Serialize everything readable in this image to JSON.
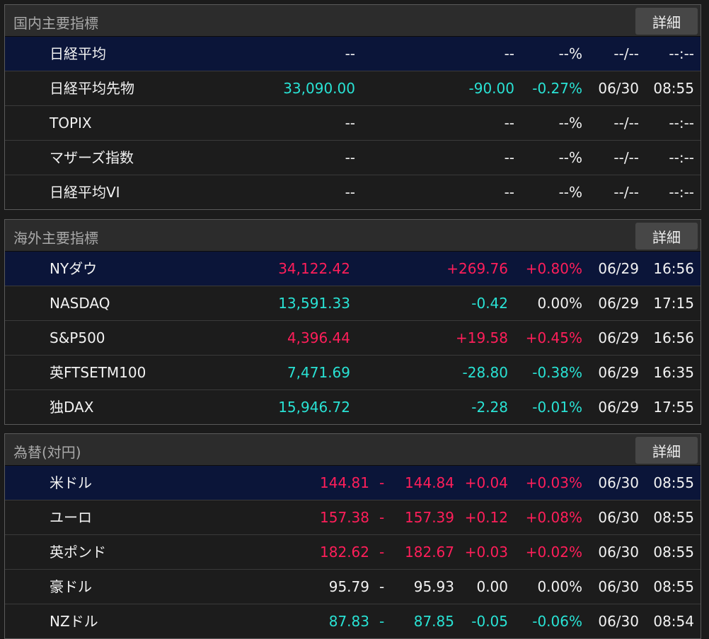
{
  "colors": {
    "up": "#ff1e5a",
    "down": "#29e2d4",
    "flat": "#f2f2f2",
    "selected_row": "#0b1539"
  },
  "domestic": {
    "title": "国内主要指標",
    "detail_label": "詳細",
    "rows": [
      {
        "name": "日経平均",
        "price": "--",
        "change": "--",
        "pct": "--%",
        "date": "--/--",
        "time": "--:--"
      },
      {
        "name": "日経平均先物",
        "price": "33,090.00",
        "change": "-90.00",
        "pct": "-0.27%",
        "date": "06/30",
        "time": "08:55"
      },
      {
        "name": "TOPIX",
        "price": "--",
        "change": "--",
        "pct": "--%",
        "date": "--/--",
        "time": "--:--"
      },
      {
        "name": "マザーズ指数",
        "price": "--",
        "change": "--",
        "pct": "--%",
        "date": "--/--",
        "time": "--:--"
      },
      {
        "name": "日経平均VI",
        "price": "--",
        "change": "--",
        "pct": "--%",
        "date": "--/--",
        "time": "--:--"
      }
    ]
  },
  "overseas": {
    "title": "海外主要指標",
    "detail_label": "詳細",
    "rows": [
      {
        "name": "NYダウ",
        "price": "34,122.42",
        "change": "+269.76",
        "pct": "+0.80%",
        "date": "06/29",
        "time": "16:56"
      },
      {
        "name": "NASDAQ",
        "price": "13,591.33",
        "change": "-0.42",
        "pct": "0.00%",
        "date": "06/29",
        "time": "17:15"
      },
      {
        "name": "S&P500",
        "price": "4,396.44",
        "change": "+19.58",
        "pct": "+0.45%",
        "date": "06/29",
        "time": "16:56"
      },
      {
        "name": "英FTSETM100",
        "price": "7,471.69",
        "change": "-28.80",
        "pct": "-0.38%",
        "date": "06/29",
        "time": "16:35"
      },
      {
        "name": "独DAX",
        "price": "15,946.72",
        "change": "-2.28",
        "pct": "-0.01%",
        "date": "06/29",
        "time": "17:55"
      }
    ]
  },
  "fx": {
    "title": "為替(対円)",
    "detail_label": "詳細",
    "rows": [
      {
        "name": "米ドル",
        "bid": "144.81",
        "sep": "-",
        "ask": "144.84",
        "change": "+0.04",
        "pct": "+0.03%",
        "date": "06/30",
        "time": "08:55"
      },
      {
        "name": "ユーロ",
        "bid": "157.38",
        "sep": "-",
        "ask": "157.39",
        "change": "+0.12",
        "pct": "+0.08%",
        "date": "06/30",
        "time": "08:55"
      },
      {
        "name": "英ポンド",
        "bid": "182.62",
        "sep": "-",
        "ask": "182.67",
        "change": "+0.03",
        "pct": "+0.02%",
        "date": "06/30",
        "time": "08:55"
      },
      {
        "name": "豪ドル",
        "bid": "95.79",
        "sep": "-",
        "ask": "95.93",
        "change": "0.00",
        "pct": "0.00%",
        "date": "06/30",
        "time": "08:55"
      },
      {
        "name": "NZドル",
        "bid": "87.83",
        "sep": "-",
        "ask": "87.85",
        "change": "-0.05",
        "pct": "-0.06%",
        "date": "06/30",
        "time": "08:54"
      }
    ]
  }
}
